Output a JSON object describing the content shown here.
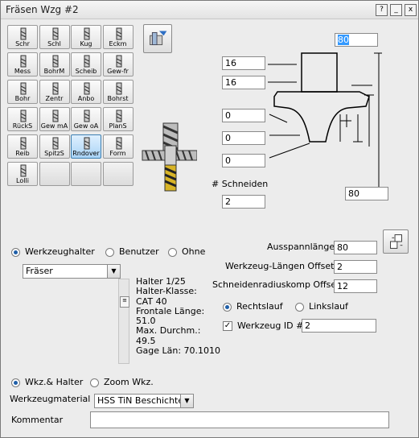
{
  "window": {
    "title": "Fräsen Wzg #2",
    "buttons": [
      "?",
      "_",
      "x"
    ]
  },
  "tools": [
    {
      "label": "Schr",
      "icon": "drill-icon"
    },
    {
      "label": "Schl",
      "icon": "end-mill-icon"
    },
    {
      "label": "Kug",
      "icon": "ball-mill-icon"
    },
    {
      "label": "Eckm",
      "icon": "corner-mill-icon"
    },
    {
      "label": "Mess",
      "icon": "measure-icon"
    },
    {
      "label": "BohrM",
      "icon": "drill-mill-icon"
    },
    {
      "label": "Scheib",
      "icon": "slitting-disc-icon"
    },
    {
      "label": "Gew-fr",
      "icon": "thread-mill-icon"
    },
    {
      "label": "Bohr",
      "icon": "bore-icon"
    },
    {
      "label": "Zentr",
      "icon": "center-drill-icon"
    },
    {
      "label": "Anbo",
      "icon": "spot-drill-icon"
    },
    {
      "label": "Bohrst",
      "icon": "boring-bar-icon"
    },
    {
      "label": "RückS",
      "icon": "back-spot-icon"
    },
    {
      "label": "Gew mA",
      "icon": "tap-icon"
    },
    {
      "label": "Gew oA",
      "icon": "tap-icon"
    },
    {
      "label": "PlanS",
      "icon": "face-mill-icon"
    },
    {
      "label": "Reib",
      "icon": "reamer-icon"
    },
    {
      "label": "SpitzS",
      "icon": "chamfer-icon"
    },
    {
      "label": "Rndover",
      "icon": "round-over-icon",
      "selected": true
    },
    {
      "label": "Form",
      "icon": "form-tool-icon"
    },
    {
      "label": "Lolli",
      "icon": "lollipop-icon"
    },
    {
      "label": "",
      "icon": ""
    },
    {
      "label": "",
      "icon": ""
    },
    {
      "label": "",
      "icon": ""
    }
  ],
  "dims": {
    "top_right": "80",
    "left_a": "16",
    "left_b": "16",
    "left_c": "0",
    "left_d": "0",
    "left_e": "0",
    "bottom_right": "80"
  },
  "flutes": {
    "label": "# Schneiden",
    "value": "2"
  },
  "holder": {
    "radio_holder": "Werkzeughalter",
    "radio_user": "Benutzer",
    "radio_none": "Ohne",
    "selected": "Werkzeughalter",
    "combo_value": "Fräser",
    "info_lines": [
      "Halter 1/25",
      "Halter-Klasse:",
      "CAT 40",
      "Frontale Länge:",
      "51.0",
      "Max. Durchm.:",
      "49.5",
      "Gage Län: 70.1010"
    ]
  },
  "fields": {
    "ausspann_label": "Ausspannlänge",
    "ausspann_value": "80",
    "len_offset_label": "Werkzeug-Längen Offset #",
    "len_offset_value": "2",
    "rad_offset_label": "Schneidenradiuskomp Offset #",
    "rad_offset_value": "12"
  },
  "rotation": {
    "right_label": "Rechtslauf",
    "left_label": "Linkslauf",
    "selected": "Rechtslauf"
  },
  "tool_id": {
    "label": "Werkzeug ID #",
    "value": "2",
    "checked": true
  },
  "view": {
    "option_a": "Wkz.& Halter",
    "option_b": "Zoom Wkz.",
    "selected": "Wkz.& Halter"
  },
  "material": {
    "label": "Werkzeugmaterial",
    "value": "HSS TiN Beschichtet"
  },
  "comment": {
    "label": "Kommentar",
    "value": ""
  },
  "colors": {
    "selection": "#3399ff",
    "tool_selected": "#a9d3f5",
    "flute_gold": "#d8b426"
  }
}
